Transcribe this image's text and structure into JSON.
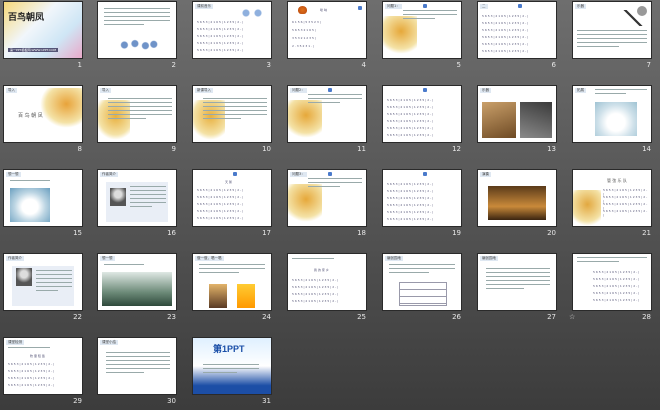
{
  "slides": [
    {
      "number": "1",
      "kind": "title",
      "title": "百鸟朝凤",
      "subtitle": "第一PPT模板网-WWW.1PPT.COM"
    },
    {
      "number": "2",
      "kind": "text-birds"
    },
    {
      "number": "3",
      "kind": "score-birds",
      "label": "课前音乐"
    },
    {
      "number": "4",
      "kind": "score-butterfly",
      "label": "唢 呐",
      "score_rows": [
        "6 1 5 6 | 5 3 5 2 3 |",
        "5 6 5 3 2 1 6 5 |",
        "3 5 3 2 1 2 3 5 |",
        "2 . 3 5 2 3 1 . |"
      ]
    },
    {
      "number": "5",
      "kind": "listen",
      "label": "问题1："
    },
    {
      "number": "6",
      "kind": "score",
      "label": "二"
    },
    {
      "number": "7",
      "kind": "instrument",
      "label": "乐器"
    },
    {
      "number": "8",
      "kind": "cover",
      "label": "导入",
      "cover_text": "百 鸟 朝 凤"
    },
    {
      "number": "9",
      "kind": "text-leaf",
      "label": "导入"
    },
    {
      "number": "10",
      "kind": "text-leaf",
      "label": "新课导入"
    },
    {
      "number": "11",
      "kind": "listen",
      "label": "问题2："
    },
    {
      "number": "12",
      "kind": "score",
      "label": ""
    },
    {
      "number": "13",
      "kind": "photo-instrument",
      "label": "乐器"
    },
    {
      "number": "14",
      "kind": "swan",
      "label": "拓展"
    },
    {
      "number": "15",
      "kind": "swan-q",
      "label": "想一想"
    },
    {
      "number": "16",
      "kind": "portrait",
      "label": "作者简介"
    },
    {
      "number": "17",
      "kind": "score-title",
      "label": "天 鹅"
    },
    {
      "number": "18",
      "kind": "listen",
      "label": "问题3："
    },
    {
      "number": "19",
      "kind": "score",
      "label": ""
    },
    {
      "number": "20",
      "kind": "orchestra",
      "label": "演奏"
    },
    {
      "number": "21",
      "kind": "score-cover",
      "label": "",
      "cover_text": "管 弦 乐 队"
    },
    {
      "number": "22",
      "kind": "portrait2",
      "label": "作者简介"
    },
    {
      "number": "23",
      "kind": "landscape",
      "label": "想一想"
    },
    {
      "number": "24",
      "kind": "activity",
      "label": "做一做，唱一唱"
    },
    {
      "number": "25",
      "kind": "score-title2",
      "label": "",
      "score_title": "我 的 家 乡"
    },
    {
      "number": "26",
      "kind": "table",
      "label": "编创园地"
    },
    {
      "number": "27",
      "kind": "text",
      "label": "编创园地"
    },
    {
      "number": "28",
      "kind": "score-tall",
      "label": "",
      "star": true
    },
    {
      "number": "29",
      "kind": "score-title2",
      "label": "课堂检测",
      "score_title": "牧 童 短 笛"
    },
    {
      "number": "30",
      "kind": "text",
      "label": "课堂小结"
    },
    {
      "number": "31",
      "kind": "brand",
      "label": "",
      "logo": "第1PPT"
    }
  ]
}
